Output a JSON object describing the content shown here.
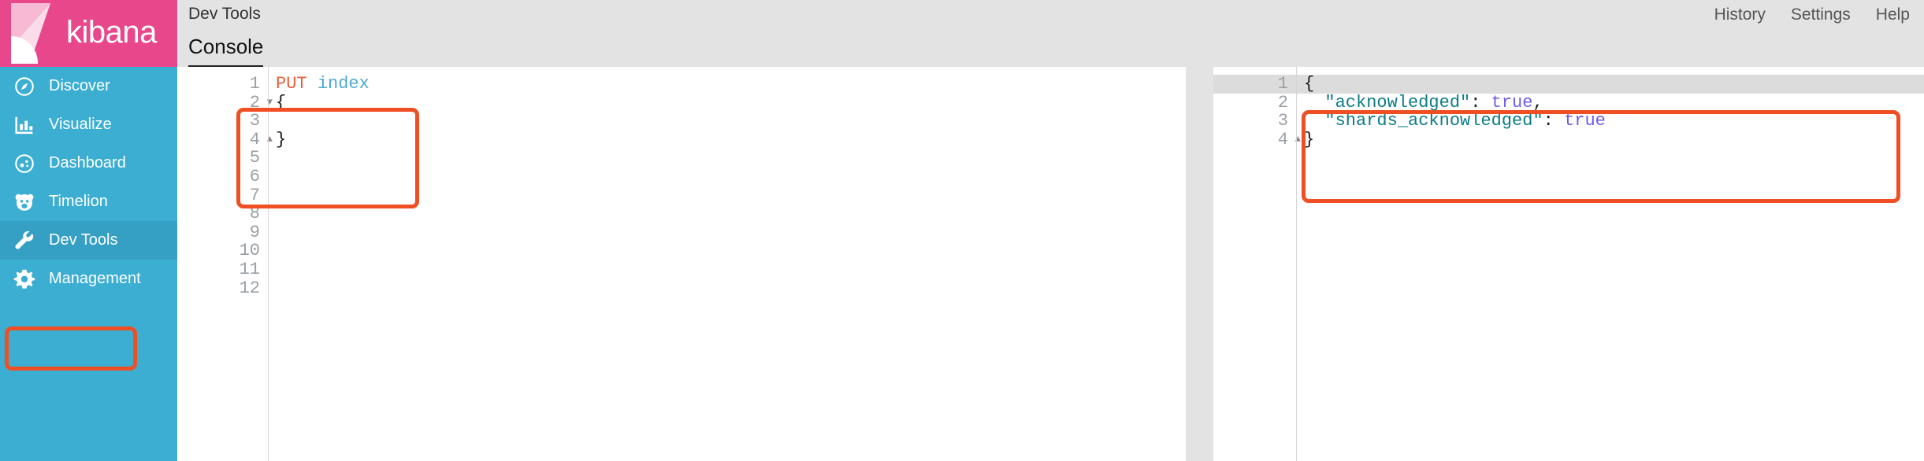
{
  "brand": {
    "name": "kibana",
    "logo_icon": "kibana-logo-icon",
    "background_color": "#e8488b"
  },
  "sidebar": {
    "background_color": "#3caed2",
    "active_background_color": "#35a0c4",
    "items": [
      {
        "label": "Discover",
        "icon": "compass-icon",
        "active": false
      },
      {
        "label": "Visualize",
        "icon": "bar-chart-icon",
        "active": false
      },
      {
        "label": "Dashboard",
        "icon": "dashboard-icon",
        "active": false
      },
      {
        "label": "Timelion",
        "icon": "bear-icon",
        "active": false
      },
      {
        "label": "Dev Tools",
        "icon": "wrench-icon",
        "active": true
      },
      {
        "label": "Management",
        "icon": "gear-icon",
        "active": false
      }
    ]
  },
  "header": {
    "title": "Dev Tools",
    "links": [
      {
        "label": "History"
      },
      {
        "label": "Settings"
      },
      {
        "label": "Help"
      }
    ],
    "tabs": [
      {
        "label": "Console",
        "active": true
      }
    ]
  },
  "console": {
    "request_editor": {
      "line_numbers": [
        "1",
        "2",
        "3",
        "4",
        "5",
        "6",
        "7",
        "8",
        "9",
        "10",
        "11",
        "12"
      ],
      "fold_lines": {
        "2": "open",
        "4": "close"
      },
      "lines": [
        {
          "tokens": [
            {
              "text": "PUT ",
              "type": "method"
            },
            {
              "text": "index",
              "type": "url"
            }
          ]
        },
        {
          "tokens": [
            {
              "text": "{",
              "type": "punct"
            }
          ]
        },
        {
          "tokens": []
        },
        {
          "tokens": [
            {
              "text": "}",
              "type": "punct"
            }
          ]
        },
        {
          "tokens": []
        },
        {
          "tokens": []
        },
        {
          "tokens": []
        },
        {
          "tokens": []
        },
        {
          "tokens": []
        },
        {
          "tokens": []
        },
        {
          "tokens": []
        },
        {
          "tokens": []
        }
      ]
    },
    "response_viewer": {
      "line_numbers": [
        "1",
        "2",
        "3",
        "4"
      ],
      "fold_lines": {
        "1": "open",
        "4": "close"
      },
      "highlighted_line": 1,
      "lines": [
        {
          "tokens": [
            {
              "text": "{",
              "type": "punct"
            }
          ],
          "highlighted": true
        },
        {
          "tokens": [
            {
              "text": "  \"acknowledged\"",
              "type": "key"
            },
            {
              "text": ": ",
              "type": "punct"
            },
            {
              "text": "true",
              "type": "bool"
            },
            {
              "text": ",",
              "type": "punct"
            }
          ],
          "highlighted": false
        },
        {
          "tokens": [
            {
              "text": "  \"shards_acknowledged\"",
              "type": "key"
            },
            {
              "text": ": ",
              "type": "punct"
            },
            {
              "text": "true",
              "type": "bool"
            }
          ],
          "highlighted": false
        },
        {
          "tokens": [
            {
              "text": "}",
              "type": "punct"
            }
          ],
          "highlighted": false
        }
      ]
    }
  },
  "annotations": {
    "color": "#f04e23",
    "boxes": [
      {
        "name": "dev-tools-nav-highlight"
      },
      {
        "name": "request-editor-highlight"
      },
      {
        "name": "response-viewer-highlight"
      }
    ]
  }
}
